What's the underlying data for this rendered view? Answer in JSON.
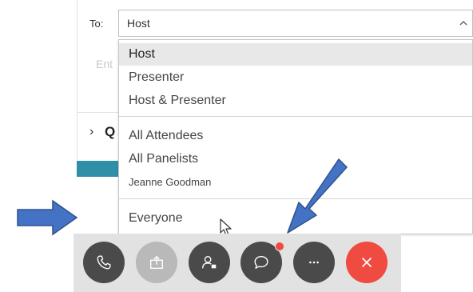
{
  "compose": {
    "to_label": "To:",
    "to_value": "Host",
    "entry_placeholder_fragment": "Ent",
    "collapsed_section_letter": "Q"
  },
  "recipient_dropdown": {
    "groups": [
      [
        "Host",
        "Presenter",
        "Host & Presenter"
      ],
      [
        "All Attendees",
        "All Panelists",
        "Jeanne Goodman"
      ],
      [
        "Everyone"
      ]
    ],
    "selected": "Host"
  },
  "toolbar": {
    "buttons": [
      {
        "icon": "phone-icon",
        "state": "active"
      },
      {
        "icon": "share-icon",
        "state": "disabled"
      },
      {
        "icon": "participants-icon",
        "state": "active"
      },
      {
        "icon": "chat-icon",
        "state": "active",
        "notification": true
      },
      {
        "icon": "more-icon",
        "state": "active"
      },
      {
        "icon": "close-icon",
        "state": "danger"
      }
    ]
  },
  "colors": {
    "button_dark": "#4a4a4a",
    "button_disabled": "#b9b9b9",
    "button_danger": "#f04b40",
    "toolbar_bg": "#e2e2e2",
    "accent_teal": "#2f8ea8",
    "arrow_blue": "#4472c4"
  }
}
